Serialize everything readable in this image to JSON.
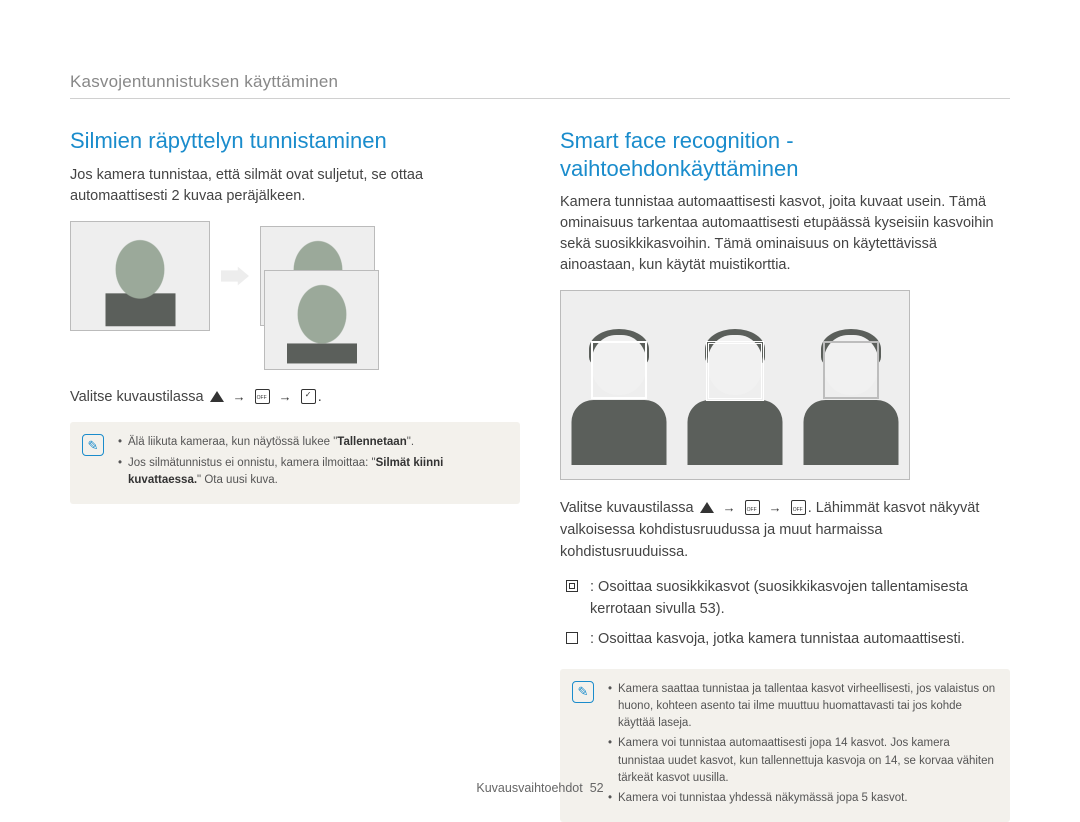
{
  "header": "Kasvojentunnistuksen käyttäminen",
  "left": {
    "title": "Silmien räpyttelyn tunnistaminen",
    "intro": "Jos kamera tunnistaa, että silmät ovat suljetut, se ottaa automaattisesti 2 kuvaa peräjälkeen.",
    "instruction_prefix": "Valitse kuvaustilassa",
    "note_items": [
      {
        "pre": "Älä liikuta kameraa, kun näytössä lukee \"",
        "bold": "Tallennetaan",
        "post": "\"."
      },
      {
        "pre": "Jos silmätunnistus ei onnistu, kamera ilmoittaa: \"",
        "bold": "Silmät kiinni kuvattaessa.",
        "post": "\" Ota uusi kuva."
      }
    ]
  },
  "right": {
    "title": "Smart face recognition -vaihtoehdonkäyttäminen",
    "intro": "Kamera tunnistaa automaattisesti kasvot, joita kuvaat usein. Tämä ominaisuus tarkentaa automaattisesti etupäässä kyseisiin kasvoihin sekä suosikkikasvoihin. Tämä ominaisuus on käytettävissä ainoastaan, kun käytät muistikorttia.",
    "instruction_prefix": "Valitse kuvaustilassa",
    "instruction_suffix": ". Lähimmät kasvot näkyvät valkoisessa kohdistusruudussa ja muut harmaissa kohdistusruuduissa.",
    "bullets": [
      ": Osoittaa suosikkikasvot (suosikkikasvojen tallentamisesta kerrotaan sivulla 53).",
      ": Osoittaa kasvoja, jotka kamera tunnistaa automaattisesti."
    ],
    "note_items": [
      "Kamera saattaa tunnistaa ja tallentaa kasvot virheellisesti, jos valaistus on huono, kohteen asento tai ilme muuttuu huomattavasti tai jos kohde käyttää laseja.",
      "Kamera voi tunnistaa automaattisesti jopa 14 kasvot. Jos kamera tunnistaa uudet kasvot, kun tallennettuja kasvoja on 14, se korvaa vähiten tärkeät kasvot uusilla.",
      "Kamera voi tunnistaa yhdessä näkymässä jopa 5 kasvot."
    ]
  },
  "footer": {
    "label": "Kuvausvaihtoehdot",
    "page": "52"
  }
}
